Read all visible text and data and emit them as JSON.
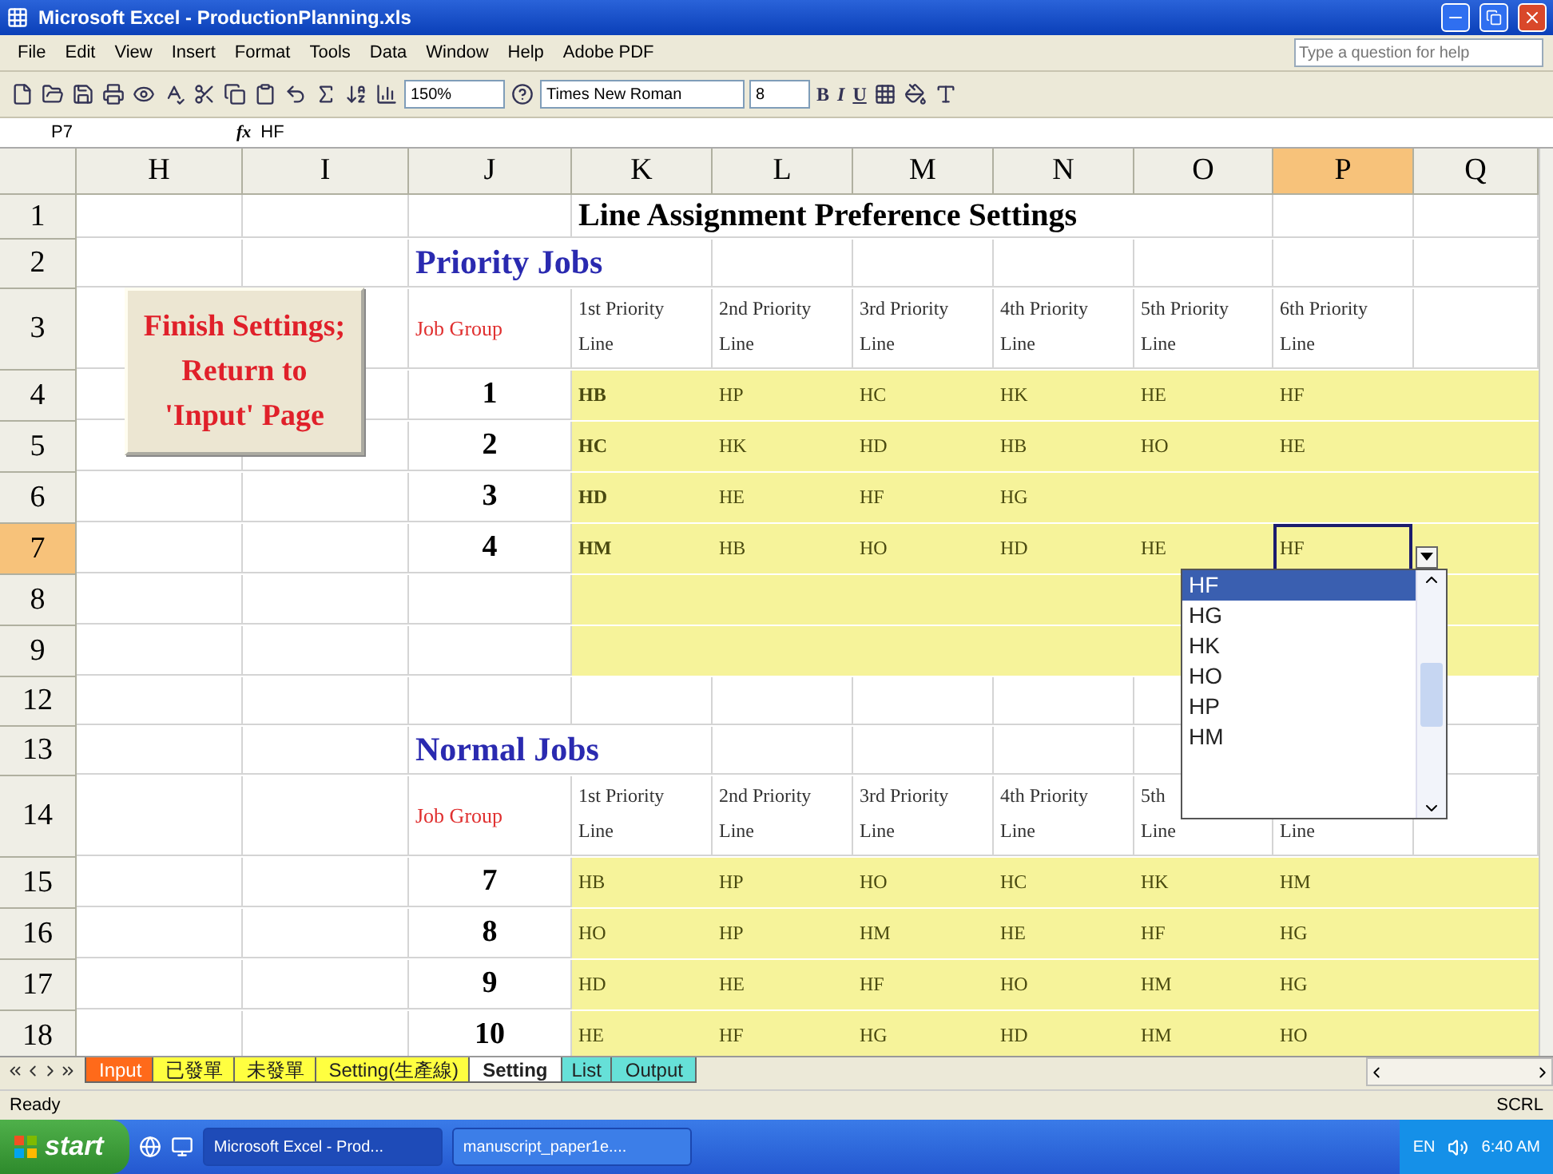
{
  "window": {
    "title": "Microsoft Excel - ProductionPlanning.xls"
  },
  "menu": [
    "File",
    "Edit",
    "View",
    "Insert",
    "Format",
    "Tools",
    "Data",
    "Window",
    "Help",
    "Adobe PDF"
  ],
  "help_box": {
    "placeholder": "Type a question for help"
  },
  "toolbar": {
    "zoom": "150%",
    "font": "Times New Roman",
    "size": "8",
    "bold": "B",
    "italic": "I",
    "underline": "U"
  },
  "formula_bar": {
    "cell": "P7",
    "fx": "fx",
    "value": "HF"
  },
  "columns": [
    {
      "label": "H",
      "selected": false
    },
    {
      "label": "I",
      "selected": false
    },
    {
      "label": "J",
      "selected": false
    },
    {
      "label": "K",
      "selected": false
    },
    {
      "label": "L",
      "selected": false
    },
    {
      "label": "M",
      "selected": false
    },
    {
      "label": "N",
      "selected": false
    },
    {
      "label": "O",
      "selected": false
    },
    {
      "label": "P",
      "selected": true
    },
    {
      "label": "Q",
      "selected": false
    }
  ],
  "rows": [
    {
      "number": "1",
      "selected": false,
      "kind": "title",
      "text": "Line Assignment Preference Settings"
    },
    {
      "number": "2",
      "selected": false,
      "kind": "section",
      "text": "Priority Jobs"
    },
    {
      "number": "3",
      "selected": false,
      "kind": "header",
      "label": "Job Group",
      "headers": [
        [
          "1st Priority",
          "Line"
        ],
        [
          "2nd Priority",
          "Line"
        ],
        [
          "3rd Priority",
          "Line"
        ],
        [
          "4th Priority",
          "Line"
        ],
        [
          "5th Priority",
          "Line"
        ],
        [
          "6th Priority",
          "Line"
        ]
      ]
    },
    {
      "number": "4",
      "selected": false,
      "kind": "job",
      "group": "1",
      "bold_first": true,
      "lines": [
        {
          "text": "HB",
          "selected": false
        },
        {
          "text": "HP",
          "selected": false
        },
        {
          "text": "HC",
          "selected": false
        },
        {
          "text": "HK",
          "selected": false
        },
        {
          "text": "HE",
          "selected": false
        },
        {
          "text": "HF",
          "selected": false
        }
      ]
    },
    {
      "number": "5",
      "selected": false,
      "kind": "job",
      "group": "2",
      "bold_first": true,
      "lines": [
        {
          "text": "HC",
          "selected": false
        },
        {
          "text": "HK",
          "selected": false
        },
        {
          "text": "HD",
          "selected": false
        },
        {
          "text": "HB",
          "selected": false
        },
        {
          "text": "HO",
          "selected": false
        },
        {
          "text": "HE",
          "selected": false
        }
      ]
    },
    {
      "number": "6",
      "selected": false,
      "kind": "job",
      "group": "3",
      "bold_first": true,
      "lines": [
        {
          "text": "HD",
          "selected": false
        },
        {
          "text": "HE",
          "selected": false
        },
        {
          "text": "HF",
          "selected": false
        },
        {
          "text": "HG",
          "selected": false
        }
      ]
    },
    {
      "number": "7",
      "selected": true,
      "kind": "job",
      "group": "4",
      "bold_first": true,
      "lines": [
        {
          "text": "HM",
          "selected": false
        },
        {
          "text": "HB",
          "selected": false
        },
        {
          "text": "HO",
          "selected": false
        },
        {
          "text": "HD",
          "selected": false
        },
        {
          "text": "HE",
          "selected": false
        },
        {
          "text": "HF",
          "selected": true
        }
      ]
    },
    {
      "number": "8",
      "selected": false,
      "kind": "fill"
    },
    {
      "number": "9",
      "selected": false,
      "kind": "fill"
    },
    {
      "number": "12",
      "selected": false,
      "kind": "blank"
    },
    {
      "number": "13",
      "selected": false,
      "kind": "section",
      "text": "Normal Jobs"
    },
    {
      "number": "14",
      "selected": false,
      "kind": "header",
      "label": "Job Group",
      "headers": [
        [
          "1st Priority",
          "Line"
        ],
        [
          "2nd Priority",
          "Line"
        ],
        [
          "3rd Priority",
          "Line"
        ],
        [
          "4th Priority",
          "Line"
        ],
        [
          "5th",
          "Line"
        ],
        [
          "Line"
        ]
      ]
    },
    {
      "number": "15",
      "selected": false,
      "kind": "job",
      "group": "7",
      "bold_first": false,
      "lines": [
        {
          "text": "HB",
          "selected": false
        },
        {
          "text": "HP",
          "selected": false
        },
        {
          "text": "HO",
          "selected": false
        },
        {
          "text": "HC",
          "selected": false
        },
        {
          "text": "HK",
          "selected": false
        },
        {
          "text": "HM",
          "selected": false
        }
      ]
    },
    {
      "number": "16",
      "selected": false,
      "kind": "job",
      "group": "8",
      "bold_first": false,
      "lines": [
        {
          "text": "HO",
          "selected": false
        },
        {
          "text": "HP",
          "selected": false
        },
        {
          "text": "HM",
          "selected": false
        },
        {
          "text": "HE",
          "selected": false
        },
        {
          "text": "HF",
          "selected": false
        },
        {
          "text": "HG",
          "selected": false
        }
      ]
    },
    {
      "number": "17",
      "selected": false,
      "kind": "job",
      "group": "9",
      "bold_first": false,
      "lines": [
        {
          "text": "HD",
          "selected": false
        },
        {
          "text": "HE",
          "selected": false
        },
        {
          "text": "HF",
          "selected": false
        },
        {
          "text": "HO",
          "selected": false
        },
        {
          "text": "HM",
          "selected": false
        },
        {
          "text": "HG",
          "selected": false
        }
      ]
    },
    {
      "number": "18",
      "selected": false,
      "kind": "job",
      "group": "10",
      "bold_first": false,
      "lines": [
        {
          "text": "HE",
          "selected": false
        },
        {
          "text": "HF",
          "selected": false
        },
        {
          "text": "HG",
          "selected": false
        },
        {
          "text": "HD",
          "selected": false
        },
        {
          "text": "HM",
          "selected": false
        },
        {
          "text": "HO",
          "selected": false
        }
      ]
    }
  ],
  "button": {
    "label": "Finish Settings; Return to 'Input' Page"
  },
  "dropdown": {
    "options": [
      {
        "text": "HF",
        "selected": true
      },
      {
        "text": "HG",
        "selected": false
      },
      {
        "text": "HK",
        "selected": false
      },
      {
        "text": "HO",
        "selected": false
      },
      {
        "text": "HP",
        "selected": false
      },
      {
        "text": "HM",
        "selected": false
      }
    ]
  },
  "sheet_tabs": [
    {
      "label": "Input",
      "selected": false,
      "color": "#ff6a1a"
    },
    {
      "label": "已發單",
      "selected": false,
      "color": "#ffff40"
    },
    {
      "label": "未發單",
      "selected": false,
      "color": "#ffff40"
    },
    {
      "label": "Setting(生產線)",
      "selected": false,
      "color": "#ffff40"
    },
    {
      "label": "Setting",
      "selected": true,
      "color": "#ffffff"
    },
    {
      "label": "List",
      "selected": false,
      "color": "#66e0d8"
    },
    {
      "label": "Output",
      "selected": false,
      "color": "#66e0d8"
    }
  ],
  "status_bar": {
    "text": "Ready",
    "indicator": "SCRL"
  },
  "taskbar": {
    "start": "start",
    "tasks": [
      {
        "label": "Microsoft Excel - Prod...",
        "selected": true
      },
      {
        "label": "manuscript_paper1e....",
        "selected": false
      }
    ],
    "language": "EN",
    "clock": "6:40 AM"
  }
}
